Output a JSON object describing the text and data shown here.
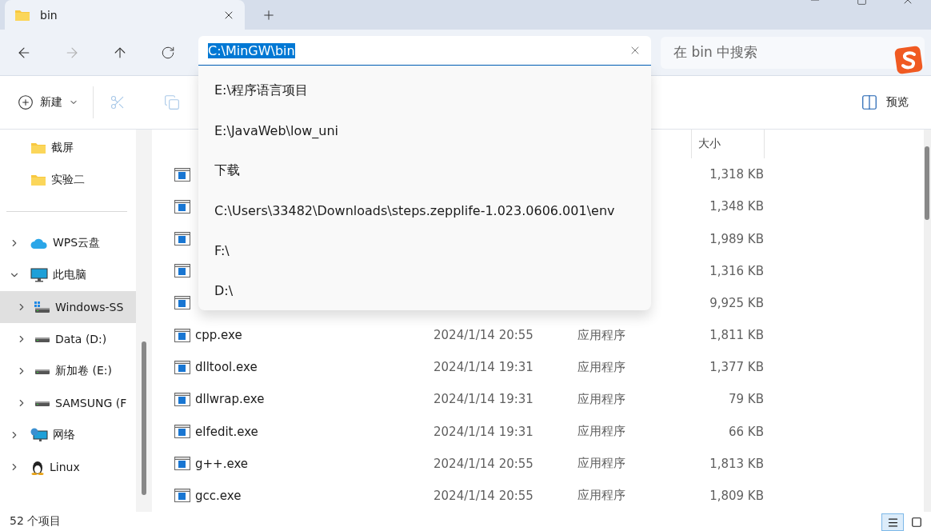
{
  "tabs": [
    {
      "title": "bin",
      "selected": true
    }
  ],
  "address_bar": {
    "value": "C:\\MinGW\\bin",
    "selected": true
  },
  "address_suggestions": [
    "E:\\程序语言项目",
    "E:\\JavaWeb\\low_uni",
    "下载",
    "C:\\Users\\33482\\Downloads\\steps.zepplife-1.023.0606.001\\env",
    "F:\\",
    "D:\\"
  ],
  "search": {
    "placeholder": "在 bin 中搜索"
  },
  "toolbar": {
    "items": [
      {
        "kind": "new",
        "label": "新建",
        "disabled": false
      },
      {
        "kind": "cut",
        "disabled": true
      },
      {
        "kind": "copy",
        "disabled": true
      }
    ],
    "preview": {
      "label": "预览"
    }
  },
  "sidebar": {
    "sections": [
      {
        "items": [
          {
            "kind": "folder",
            "label": "截屏",
            "selected": false
          },
          {
            "kind": "folder",
            "label": "实验二",
            "selected": false
          }
        ]
      },
      {
        "items": [
          {
            "kind": "cloud",
            "label": "WPS云盘",
            "selected": false,
            "expanded": false
          },
          {
            "kind": "pc",
            "label": "此电脑",
            "selected": false,
            "expanded": true,
            "children": [
              {
                "kind": "system-drive",
                "label": "Windows-SS",
                "selected": true,
                "expanded": false
              },
              {
                "kind": "drive",
                "label": "Data (D:)",
                "selected": false,
                "expanded": false
              },
              {
                "kind": "drive",
                "label": "新加卷 (E:)",
                "selected": false,
                "expanded": false
              },
              {
                "kind": "drive",
                "label": "SAMSUNG (F",
                "selected": false,
                "expanded": false
              }
            ]
          },
          {
            "kind": "network",
            "label": "网络",
            "selected": false,
            "expanded": false
          },
          {
            "kind": "linux",
            "label": "Linux",
            "selected": false,
            "expanded": false
          }
        ]
      }
    ]
  },
  "table": {
    "columns": {
      "size": "大小"
    },
    "rows": [
      {
        "size": "1,318 KB"
      },
      {
        "size": "1,348 KB"
      },
      {
        "size": "1,989 KB"
      },
      {
        "size": "1,316 KB"
      },
      {
        "size": "9,925 KB"
      },
      {
        "name": "cpp.exe",
        "date": "2024/1/14 20:55",
        "type": "应用程序",
        "size": "1,811 KB"
      },
      {
        "name": "dlltool.exe",
        "date": "2024/1/14 19:31",
        "type": "应用程序",
        "size": "1,377 KB"
      },
      {
        "name": "dllwrap.exe",
        "date": "2024/1/14 19:31",
        "type": "应用程序",
        "size": "79 KB"
      },
      {
        "name": "elfedit.exe",
        "date": "2024/1/14 19:31",
        "type": "应用程序",
        "size": "66 KB"
      },
      {
        "name": "g++.exe",
        "date": "2024/1/14 20:55",
        "type": "应用程序",
        "size": "1,813 KB"
      },
      {
        "name": "gcc.exe",
        "date": "2024/1/14 20:55",
        "type": "应用程序",
        "size": "1,809 KB"
      }
    ]
  },
  "status_bar": {
    "item_count": "52 个项目"
  },
  "view_buttons": [
    {
      "kind": "details",
      "selected": true
    },
    {
      "kind": "tiles",
      "selected": false
    }
  ]
}
